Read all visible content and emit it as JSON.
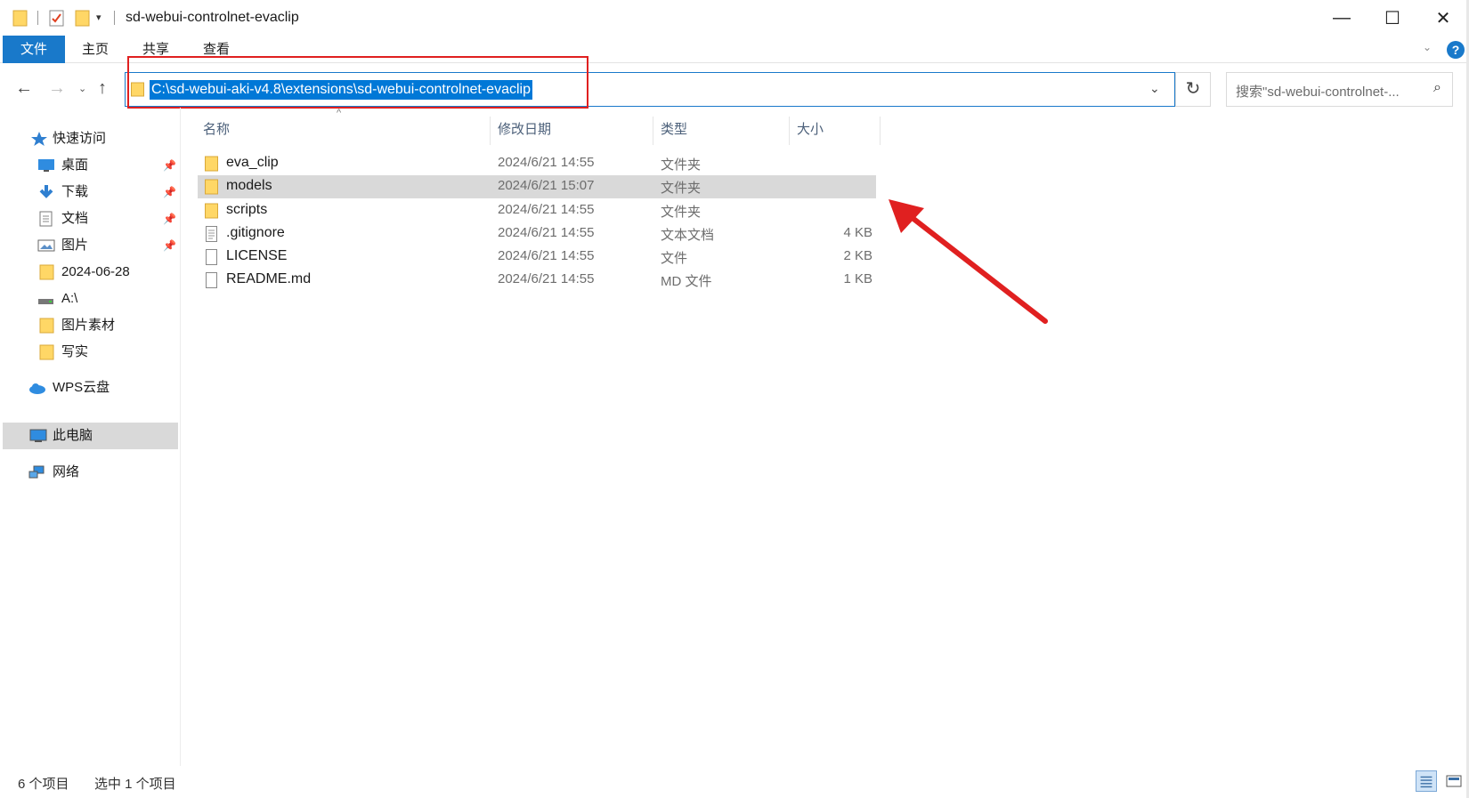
{
  "window": {
    "title": "sd-webui-controlnet-evaclip",
    "min_symbol": "—",
    "max_symbol": "☐",
    "close_symbol": "✕"
  },
  "ribbon": {
    "tabs": [
      "文件",
      "主页",
      "共享",
      "查看"
    ],
    "help_symbol": "?"
  },
  "address": {
    "path": "C:\\sd-webui-aki-v4.8\\extensions\\sd-webui-controlnet-evaclip"
  },
  "search": {
    "placeholder": "搜索\"sd-webui-controlnet-..."
  },
  "nav": {
    "quick_access": "快速访问",
    "items": [
      {
        "label": "桌面",
        "icon": "desktop-icon",
        "pinned": true
      },
      {
        "label": "下载",
        "icon": "download-icon",
        "pinned": true
      },
      {
        "label": "文档",
        "icon": "document-icon",
        "pinned": true
      },
      {
        "label": "图片",
        "icon": "pictures-icon",
        "pinned": true
      },
      {
        "label": "2024-06-28",
        "icon": "folder-icon",
        "pinned": false
      },
      {
        "label": "A:\\",
        "icon": "drive-icon",
        "pinned": false
      },
      {
        "label": "图片素材",
        "icon": "folder-icon",
        "pinned": false
      },
      {
        "label": "写实",
        "icon": "folder-icon",
        "pinned": false
      }
    ],
    "wps": "WPS云盘",
    "this_pc": "此电脑",
    "network": "网络"
  },
  "columns": {
    "name": "名称",
    "date": "修改日期",
    "type": "类型",
    "size": "大小"
  },
  "files": [
    {
      "name": "eva_clip",
      "date": "2024/6/21 14:55",
      "type": "文件夹",
      "size": "",
      "kind": "folder"
    },
    {
      "name": "models",
      "date": "2024/6/21 15:07",
      "type": "文件夹",
      "size": "",
      "kind": "folder"
    },
    {
      "name": "scripts",
      "date": "2024/6/21 14:55",
      "type": "文件夹",
      "size": "",
      "kind": "folder"
    },
    {
      "name": ".gitignore",
      "date": "2024/6/21 14:55",
      "type": "文本文档",
      "size": "4 KB",
      "kind": "text"
    },
    {
      "name": "LICENSE",
      "date": "2024/6/21 14:55",
      "type": "文件",
      "size": "2 KB",
      "kind": "file"
    },
    {
      "name": "README.md",
      "date": "2024/6/21 14:55",
      "type": "MD 文件",
      "size": "1 KB",
      "kind": "file"
    }
  ],
  "status": {
    "count": "6 个项目",
    "selected": "选中 1 个项目"
  },
  "colors": {
    "accent": "#1979ca",
    "selection": "#0078d7",
    "annotation": "#e02020",
    "folder": "#ffd766"
  }
}
